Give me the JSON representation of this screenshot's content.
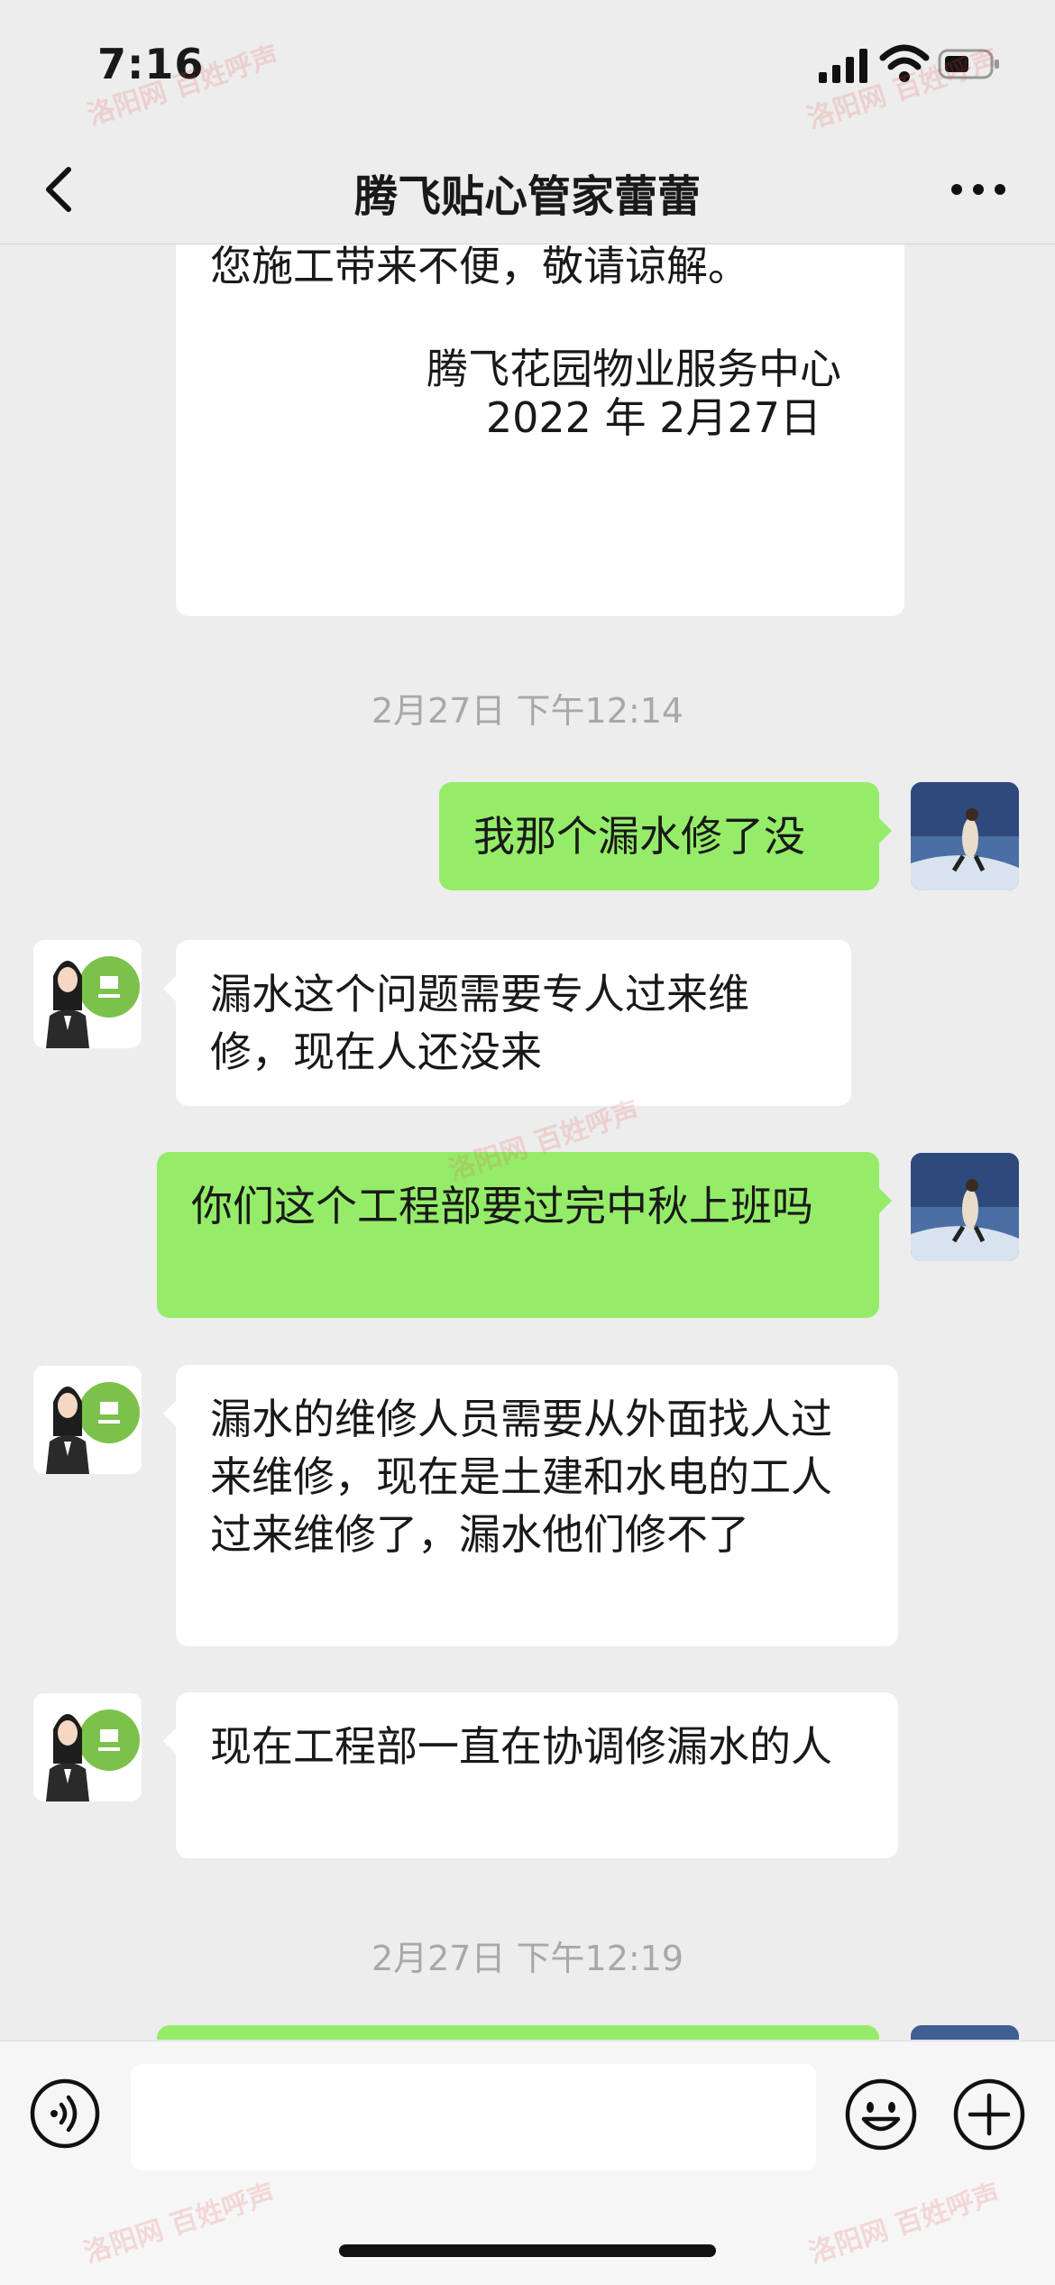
{
  "status_bar": {
    "time": "7:16"
  },
  "nav": {
    "title": "腾飞贴心管家蕾蕾"
  },
  "messages": {
    "notice_line1": "您施工带来不便，敬请谅解。",
    "notice_signature": "腾飞花园物业服务中心",
    "notice_date": "2022 年 2月27日",
    "timestamp_1": "2月27日 下午12:14",
    "msg_out_1": "我那个漏水修了没",
    "msg_in_1": "漏水这个问题需要专人过来维修，现在人还没来",
    "msg_out_2": "你们这个工程部要过完中秋上班吗",
    "msg_in_2": "漏水的维修人员需要从外面找人过来维修，现在是土建和水电的工人过来维修了，漏水他们修不了",
    "msg_in_3": "现在工程部一直在协调修漏水的人",
    "timestamp_2": "2月27日 下午12:19"
  },
  "watermark": {
    "text": "洛阳网 百姓呼声"
  },
  "colors": {
    "background": "#ededed",
    "outgoing_bubble": "#95ec69",
    "incoming_bubble": "#ffffff",
    "timestamp_text": "#a8a8a8"
  },
  "icons": {
    "back": "back-chevron-icon",
    "more": "more-dots-icon",
    "voice": "voice-icon",
    "emoji": "emoji-icon",
    "plus": "plus-icon"
  }
}
